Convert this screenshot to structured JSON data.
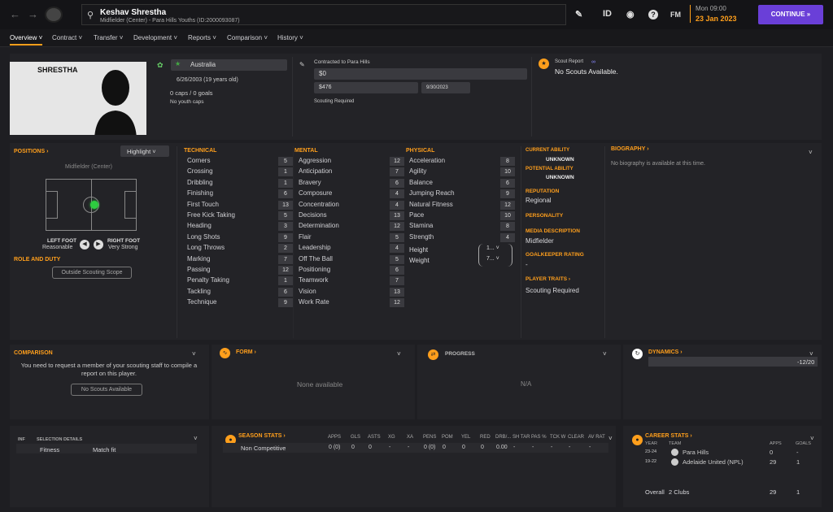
{
  "header": {
    "player_name": "Keshav Shrestha",
    "player_sub": "Midfielder (Center) - Para Hills Youths (ID:2000093087)",
    "icons": [
      "back-icon",
      "forward-icon",
      "search-icon",
      "pen-icon",
      "id-icon",
      "badge-icon",
      "help-icon",
      "fm-icon"
    ],
    "id_label": "ID",
    "fm_label": "FM",
    "date_line1": "Mon 09:00",
    "date_line2": "23 Jan 2023",
    "continue_label": "CONTINUE »"
  },
  "tabs": [
    "Overview",
    "Contract",
    "Transfer",
    "Development",
    "Reports",
    "Comparison",
    "History"
  ],
  "profile": {
    "surname": "SHRESTHA",
    "nation": "Australia",
    "dob": "6/26/2003 (19 years old)",
    "caps": "0 caps / 0 goals",
    "youth_caps": "No youth caps",
    "contract_title": "Contracted to Para Hills",
    "wage": "$0",
    "value": "$476",
    "expiry": "9/30/2023",
    "scouting_required": "Scouting Required",
    "scout_report_title": "Scout Report",
    "scout_report_value": "No Scouts Available."
  },
  "positions": {
    "title": "POSITIONS",
    "highlight": "Highlight",
    "position": "Midfielder (Center)",
    "left_foot_label": "LEFT FOOT",
    "left_foot_value": "Reasonable",
    "right_foot_label": "RIGHT FOOT",
    "right_foot_value": "Very Strong",
    "role_title": "ROLE AND DUTY",
    "role_button": "Outside Scouting Scope"
  },
  "technical": {
    "title": "TECHNICAL",
    "rows": [
      {
        "n": "Corners",
        "v": "5"
      },
      {
        "n": "Crossing",
        "v": "1"
      },
      {
        "n": "Dribbling",
        "v": "1"
      },
      {
        "n": "Finishing",
        "v": "6"
      },
      {
        "n": "First Touch",
        "v": "13"
      },
      {
        "n": "Free Kick Taking",
        "v": "5"
      },
      {
        "n": "Heading",
        "v": "3"
      },
      {
        "n": "Long Shots",
        "v": "9"
      },
      {
        "n": "Long Throws",
        "v": "2"
      },
      {
        "n": "Marking",
        "v": "7"
      },
      {
        "n": "Passing",
        "v": "12"
      },
      {
        "n": "Penalty Taking",
        "v": "1"
      },
      {
        "n": "Tackling",
        "v": "6"
      },
      {
        "n": "Technique",
        "v": "9"
      }
    ]
  },
  "mental": {
    "title": "MENTAL",
    "rows": [
      {
        "n": "Aggression",
        "v": "12"
      },
      {
        "n": "Anticipation",
        "v": "7"
      },
      {
        "n": "Bravery",
        "v": "6"
      },
      {
        "n": "Composure",
        "v": "4"
      },
      {
        "n": "Concentration",
        "v": "4"
      },
      {
        "n": "Decisions",
        "v": "13"
      },
      {
        "n": "Determination",
        "v": "12"
      },
      {
        "n": "Flair",
        "v": "5"
      },
      {
        "n": "Leadership",
        "v": "4"
      },
      {
        "n": "Off The Ball",
        "v": "5"
      },
      {
        "n": "Positioning",
        "v": "6"
      },
      {
        "n": "Teamwork",
        "v": "7"
      },
      {
        "n": "Vision",
        "v": "13"
      },
      {
        "n": "Work Rate",
        "v": "12"
      }
    ]
  },
  "physical": {
    "title": "PHYSICAL",
    "rows": [
      {
        "n": "Acceleration",
        "v": "8"
      },
      {
        "n": "Agility",
        "v": "10"
      },
      {
        "n": "Balance",
        "v": "6"
      },
      {
        "n": "Jumping Reach",
        "v": "9"
      },
      {
        "n": "Natural Fitness",
        "v": "12"
      },
      {
        "n": "Pace",
        "v": "10"
      },
      {
        "n": "Stamina",
        "v": "8"
      },
      {
        "n": "Strength",
        "v": "4"
      }
    ],
    "height_label": "Height",
    "height_value": "1...",
    "weight_label": "Weight",
    "weight_value": "7..."
  },
  "ability": {
    "current_label": "CURRENT ABILITY",
    "current_value": "UNKNOWN",
    "potential_label": "POTENTIAL ABILITY",
    "potential_value": "UNKNOWN",
    "reputation_label": "REPUTATION",
    "reputation_value": "Regional",
    "personality_label": "PERSONALITY",
    "media_label": "MEDIA DESCRIPTION",
    "media_value": "Midfielder",
    "gk_label": "GOALKEEPER RATING",
    "gk_value": "-",
    "traits_label": "PLAYER TRAITS",
    "traits_value": "Scouting Required"
  },
  "biography": {
    "title": "BIOGRAPHY",
    "text": "No biography is available at this time."
  },
  "comparison": {
    "title": "COMPARISON",
    "text": "You need to request a member of your scouting staff to compile a report on this player.",
    "button": "No Scouts Available"
  },
  "form": {
    "title": "FORM",
    "value": "None available"
  },
  "progress": {
    "title": "PROGRESS",
    "value": "N/A"
  },
  "dynamics": {
    "title": "DYNAMICS",
    "value": "-12/20",
    "fraction": 0.0
  },
  "selection": {
    "inf": "INF",
    "title": "SELECTION DETAILS",
    "row_label": "Fitness",
    "row_value": "Match fit"
  },
  "season_stats": {
    "title": "SEASON STATS",
    "headers": [
      "APPS",
      "GLS",
      "ASTS",
      "XG",
      "XA",
      "PENS",
      "POM",
      "YEL",
      "RED",
      "DRB/...",
      "SH TAR",
      "PAS %",
      "TCK W",
      "CLEAR",
      "AV RAT"
    ],
    "row_label": "Non Competitive",
    "values": [
      "0 (0)",
      "0",
      "0",
      "-",
      "-",
      "0 (0)",
      "0",
      "0",
      "0",
      "0.00",
      "-",
      "-",
      "-",
      "-",
      "-"
    ]
  },
  "career_stats": {
    "title": "CAREER STATS",
    "h_year": "YEAR",
    "h_team": "TEAM",
    "h_apps": "APPS",
    "h_goals": "GOALS",
    "rows": [
      {
        "year": "23-24",
        "team": "Para Hills",
        "apps": "0",
        "goals": "-"
      },
      {
        "year": "19-22",
        "team": "Adelaide United (NPL)",
        "apps": "29",
        "goals": "1"
      }
    ],
    "overall_label": "Overall",
    "overall_clubs": "2 Clubs",
    "overall_apps": "29",
    "overall_goals": "1"
  }
}
